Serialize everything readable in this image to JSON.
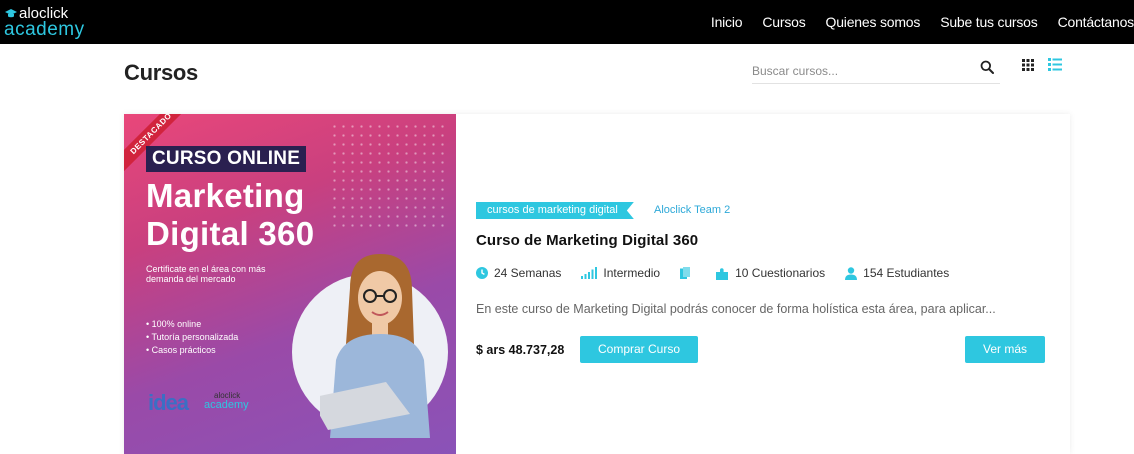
{
  "brand": {
    "line1": "aloclick",
    "line2": "academy",
    "accent": "#2ec7e0"
  },
  "nav": {
    "items": [
      "Inicio",
      "Cursos",
      "Quienes somos",
      "Sube tus cursos",
      "Contáctanos"
    ]
  },
  "header": {
    "title": "Cursos",
    "search_placeholder": "Buscar cursos..."
  },
  "icons": {
    "search": "search-icon",
    "grid": "grid-view-icon",
    "list": "list-view-icon"
  },
  "course": {
    "thumbnail": {
      "ribbon": "DESTACADO",
      "badge": "CURSO ONLINE",
      "headline_1": "Marketing",
      "headline_2": "Digital 360",
      "subtitle": "Certificate en el área con más demanda del mercado",
      "bullets": [
        "100% online",
        "Tutoría personalizada",
        "Casos prácticos"
      ],
      "partner_logo": "idea",
      "brand_line1": "aloclick",
      "brand_line2": "academy"
    },
    "category": "cursos de marketing digital",
    "author": "Aloclick Team 2",
    "title": "Curso de Marketing Digital 360",
    "meta": {
      "duration": "24 Semanas",
      "level": "Intermedio",
      "quizzes": "10 Cuestionarios",
      "students": "154 Estudiantes"
    },
    "description": "En este curso de Marketing Digital podrás conocer de forma holística esta área, para aplicar...",
    "price": "$ ars 48.737,28",
    "buy_label": "Comprar Curso",
    "more_label": "Ver más"
  },
  "colors": {
    "accent": "#2ec7e0",
    "navbar": "#000000",
    "link": "#2ea9d8"
  }
}
